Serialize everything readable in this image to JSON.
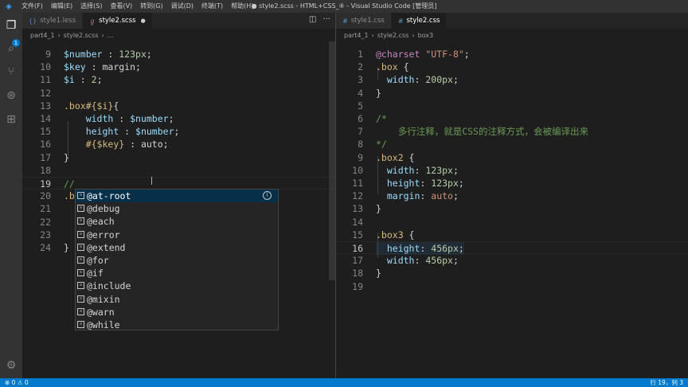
{
  "titlebar": {
    "logo": "◈",
    "menu": [
      "文件(F)",
      "编辑(E)",
      "选择(S)",
      "查看(V)",
      "转到(G)",
      "调试(D)",
      "终端(T)",
      "帮助(H)"
    ],
    "title": "● style2.scss - HTML+CSS_④ - Visual Studio Code [管理员]"
  },
  "activity": {
    "badge": "1"
  },
  "left_editor": {
    "tabs": [
      {
        "label": "style1.less",
        "icon": "{}"
      },
      {
        "label": "style2.scss",
        "icon": "ℊ",
        "dirty": "●"
      }
    ],
    "breadcrumb": [
      "part4_1",
      "style2.scss",
      "..."
    ],
    "lines": [
      {
        "n": "9",
        "tokens": [
          [
            "t-var",
            "$number"
          ],
          [
            "t-plain",
            " : "
          ],
          [
            "t-num",
            "123px"
          ],
          [
            "t-plain",
            ";"
          ]
        ]
      },
      {
        "n": "10",
        "tokens": [
          [
            "t-var",
            "$key"
          ],
          [
            "t-plain",
            " : "
          ],
          [
            "t-plain",
            "margin"
          ],
          [
            "t-plain",
            ";"
          ]
        ]
      },
      {
        "n": "11",
        "tokens": [
          [
            "t-var",
            "$i"
          ],
          [
            "t-plain",
            " : "
          ],
          [
            "t-num",
            "2"
          ],
          [
            "t-plain",
            ";"
          ]
        ]
      },
      {
        "n": "12",
        "tokens": []
      },
      {
        "n": "13",
        "tokens": [
          [
            "t-sel",
            ".box"
          ],
          [
            "t-interp",
            "#{$i}"
          ],
          [
            "t-plain",
            "{"
          ]
        ]
      },
      {
        "n": "14",
        "tokens": [
          [
            "t-plain",
            "    "
          ],
          [
            "t-prop",
            "width"
          ],
          [
            "t-plain",
            " : "
          ],
          [
            "t-var",
            "$number"
          ],
          [
            "t-plain",
            ";"
          ]
        ]
      },
      {
        "n": "15",
        "tokens": [
          [
            "t-plain",
            "    "
          ],
          [
            "t-prop",
            "height"
          ],
          [
            "t-plain",
            " : "
          ],
          [
            "t-var",
            "$number"
          ],
          [
            "t-plain",
            ";"
          ]
        ]
      },
      {
        "n": "16",
        "tokens": [
          [
            "t-plain",
            "    "
          ],
          [
            "t-interp",
            "#{$key}"
          ],
          [
            "t-plain",
            " : "
          ],
          [
            "t-plain",
            "auto"
          ],
          [
            "t-plain",
            ";"
          ]
        ]
      },
      {
        "n": "17",
        "tokens": [
          [
            "t-plain",
            "}"
          ]
        ]
      },
      {
        "n": "18",
        "tokens": []
      },
      {
        "n": "19",
        "tokens": [
          [
            "t-comment",
            "//"
          ]
        ],
        "current": true
      },
      {
        "n": "20",
        "tokens": [
          [
            "t-sel",
            ".b"
          ]
        ]
      },
      {
        "n": "21",
        "tokens": []
      },
      {
        "n": "22",
        "tokens": []
      },
      {
        "n": "23",
        "tokens": []
      },
      {
        "n": "24",
        "tokens": [
          [
            "t-plain",
            "}"
          ]
        ]
      }
    ],
    "suggestions": [
      "@at-root",
      "@debug",
      "@each",
      "@error",
      "@extend",
      "@for",
      "@if",
      "@include",
      "@mixin",
      "@warn",
      "@while"
    ]
  },
  "right_editor": {
    "tabs": [
      {
        "label": "style1.css",
        "icon": "#"
      },
      {
        "label": "style2.css",
        "icon": "#"
      }
    ],
    "breadcrumb": [
      "part4_1",
      "style2.css",
      "box3"
    ],
    "lines": [
      {
        "n": "1",
        "tokens": [
          [
            "t-at",
            "@charset"
          ],
          [
            "t-plain",
            " "
          ],
          [
            "t-val",
            "\"UTF-8\""
          ],
          [
            "t-plain",
            ";"
          ]
        ]
      },
      {
        "n": "2",
        "tokens": [
          [
            "t-sel",
            ".box"
          ],
          [
            "t-plain",
            " {"
          ]
        ]
      },
      {
        "n": "3",
        "tokens": [
          [
            "t-plain",
            "  "
          ],
          [
            "t-prop",
            "width"
          ],
          [
            "t-plain",
            ": "
          ],
          [
            "t-num",
            "200px"
          ],
          [
            "t-plain",
            ";"
          ]
        ]
      },
      {
        "n": "4",
        "tokens": [
          [
            "t-plain",
            "}"
          ]
        ]
      },
      {
        "n": "5",
        "tokens": []
      },
      {
        "n": "6",
        "tokens": [
          [
            "t-comment",
            "/*"
          ]
        ]
      },
      {
        "n": "7",
        "tokens": [
          [
            "t-comment",
            "    多行注释，就是CSS的注释方式，会被编译出来"
          ]
        ]
      },
      {
        "n": "8",
        "tokens": [
          [
            "t-comment",
            "*/"
          ]
        ]
      },
      {
        "n": "9",
        "tokens": [
          [
            "t-sel",
            ".box2"
          ],
          [
            "t-plain",
            " {"
          ]
        ]
      },
      {
        "n": "10",
        "tokens": [
          [
            "t-plain",
            "  "
          ],
          [
            "t-prop",
            "width"
          ],
          [
            "t-plain",
            ": "
          ],
          [
            "t-num",
            "123px"
          ],
          [
            "t-plain",
            ";"
          ]
        ]
      },
      {
        "n": "11",
        "tokens": [
          [
            "t-plain",
            "  "
          ],
          [
            "t-prop",
            "height"
          ],
          [
            "t-plain",
            ": "
          ],
          [
            "t-num",
            "123px"
          ],
          [
            "t-plain",
            ";"
          ]
        ]
      },
      {
        "n": "12",
        "tokens": [
          [
            "t-plain",
            "  "
          ],
          [
            "t-prop",
            "margin"
          ],
          [
            "t-plain",
            ": "
          ],
          [
            "t-val",
            "auto"
          ],
          [
            "t-plain",
            ";"
          ]
        ]
      },
      {
        "n": "13",
        "tokens": [
          [
            "t-plain",
            "}"
          ]
        ]
      },
      {
        "n": "14",
        "tokens": []
      },
      {
        "n": "15",
        "tokens": [
          [
            "t-sel",
            ".box3"
          ],
          [
            "t-plain",
            " {"
          ]
        ]
      },
      {
        "n": "16",
        "tokens": [
          [
            "t-plain",
            "  "
          ],
          [
            "t-prop",
            "height"
          ],
          [
            "t-plain",
            ": "
          ],
          [
            "t-num",
            "456px"
          ],
          [
            "t-plain",
            ";"
          ]
        ],
        "current": true
      },
      {
        "n": "17",
        "tokens": [
          [
            "t-plain",
            "  "
          ],
          [
            "t-prop",
            "width"
          ],
          [
            "t-plain",
            ": "
          ],
          [
            "t-num",
            "456px"
          ],
          [
            "t-plain",
            ";"
          ]
        ]
      },
      {
        "n": "18",
        "tokens": [
          [
            "t-plain",
            "}"
          ]
        ]
      },
      {
        "n": "19",
        "tokens": []
      }
    ]
  },
  "statusbar": {
    "left": "⊗ 0  ⚠ 0",
    "right": "行 19，列 3"
  }
}
